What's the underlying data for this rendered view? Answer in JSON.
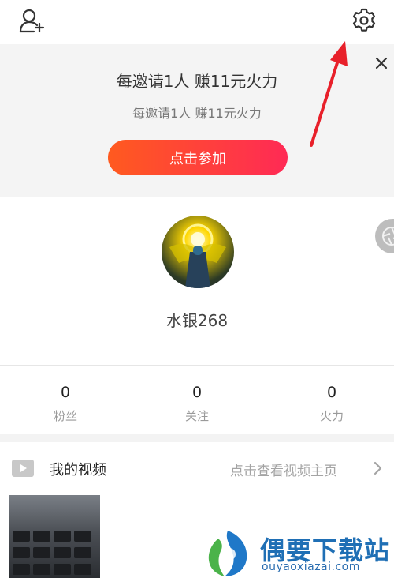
{
  "banner": {
    "title": "每邀请1人 赚11元火力",
    "subtitle": "每邀请1人 赚11元火力",
    "button_label": "点击参加"
  },
  "profile": {
    "username": "水银268"
  },
  "stats": [
    {
      "value": "0",
      "label": "粉丝"
    },
    {
      "value": "0",
      "label": "关注"
    },
    {
      "value": "0",
      "label": "火力"
    }
  ],
  "videos": {
    "title": "我的视频",
    "link_text": "点击查看视频主页"
  },
  "watermark": {
    "brand": "偶要下载站",
    "domain": "ouyaoxiazai.com"
  },
  "colors": {
    "accent_start": "#ff5a1f",
    "accent_end": "#ff2a55",
    "annotation_arrow": "#e8202a",
    "watermark_blue": "#1f6fb5"
  },
  "icons": [
    "add-friend-icon",
    "settings-gear-icon",
    "close-icon",
    "video-play-icon",
    "chevron-right-icon"
  ]
}
